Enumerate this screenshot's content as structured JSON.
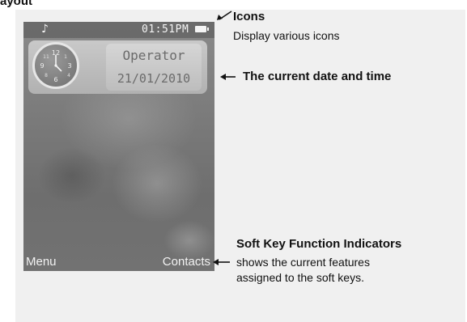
{
  "heading_fragment": "ayout",
  "phone": {
    "status_bar": {
      "music_icon": "♪",
      "time": "01:51PM"
    },
    "widget": {
      "operator": "Operator",
      "date": "21/01/2010"
    },
    "softkeys": {
      "left": "Menu",
      "right": "Contacts"
    }
  },
  "annotations": {
    "icons": {
      "title": "Icons",
      "body": "Display various icons"
    },
    "date_time": {
      "title": "The current date  and  time"
    },
    "softkeys": {
      "title": "Soft Key Function Indicators",
      "line1": "shows the current features",
      "line2": "assigned to the soft keys."
    }
  },
  "colors": {
    "panel_bg": "#f0f0f0",
    "screen_text": "#f4f4f4"
  },
  "icons": [
    "music-note-icon",
    "battery-icon",
    "clock-icon",
    "arrow-icon"
  ]
}
